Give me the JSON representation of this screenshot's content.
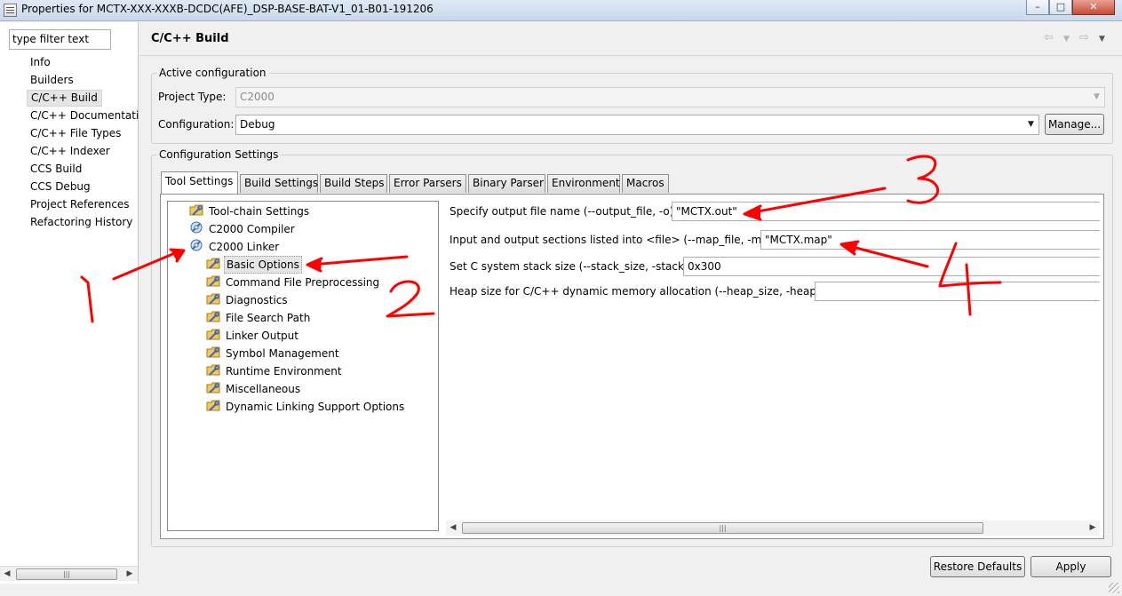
{
  "window": {
    "title": "Properties for MCTX-XXX-XXXB-DCDC(AFE)_DSP-BASE-BAT-V1_01-B01-191206",
    "minimize_glyph": "–",
    "maximize_glyph": "□",
    "close_glyph": "✕"
  },
  "filter": {
    "placeholder": "type filter text"
  },
  "nav": {
    "items": [
      {
        "label": "Info"
      },
      {
        "label": "Builders"
      },
      {
        "label": "C/C++ Build"
      },
      {
        "label": "C/C++ Documentatio"
      },
      {
        "label": "C/C++ File Types"
      },
      {
        "label": "C/C++ Indexer"
      },
      {
        "label": "CCS Build"
      },
      {
        "label": "CCS Debug"
      },
      {
        "label": "Project References"
      },
      {
        "label": "Refactoring History"
      }
    ],
    "selected_index": 2
  },
  "page": {
    "title": "C/C++ Build",
    "back_icon": "back-arrow-icon",
    "forward_icon": "forward-arrow-icon"
  },
  "active_config": {
    "group_label": "Active configuration",
    "project_type_label": "Project Type:",
    "project_type_value": "C2000",
    "configuration_label": "Configuration:",
    "configuration_value": "Debug",
    "manage_label": "Manage..."
  },
  "config_settings": {
    "group_label": "Configuration Settings",
    "tabs": [
      {
        "label": "Tool Settings"
      },
      {
        "label": "Build Settings"
      },
      {
        "label": "Build Steps"
      },
      {
        "label": "Error Parsers"
      },
      {
        "label": "Binary Parser"
      },
      {
        "label": "Environment"
      },
      {
        "label": "Macros"
      }
    ],
    "active_tab_index": 0
  },
  "tree": {
    "items": [
      {
        "label": "Tool-chain Settings"
      },
      {
        "label": "C2000 Compiler"
      },
      {
        "label": "C2000 Linker"
      },
      {
        "label": "Basic Options"
      },
      {
        "label": "Command File Preprocessing"
      },
      {
        "label": "Diagnostics"
      },
      {
        "label": "File Search Path"
      },
      {
        "label": "Linker Output"
      },
      {
        "label": "Symbol Management"
      },
      {
        "label": "Runtime Environment"
      },
      {
        "label": "Miscellaneous"
      },
      {
        "label": "Dynamic Linking Support Options"
      }
    ],
    "selected_index": 3
  },
  "options": [
    {
      "label": "Specify output file name (--output_file, -o)",
      "value": "\"MCTX.out\""
    },
    {
      "label": "Input and output sections listed into <file> (--map_file, -m)",
      "value": "\"MCTX.map\""
    },
    {
      "label": "Set C system stack size (--stack_size, -stack)",
      "value": "0x300"
    },
    {
      "label": "Heap size for C/C++ dynamic memory allocation (--heap_size, -heap)",
      "value": ""
    }
  ],
  "buttons": {
    "restore_defaults": "Restore Defaults",
    "apply": "Apply"
  },
  "annotations": [
    "1",
    "2",
    "3",
    "4"
  ],
  "colors": {
    "annotation": "#ff0000",
    "selection_bg": "#e5e5e5"
  }
}
